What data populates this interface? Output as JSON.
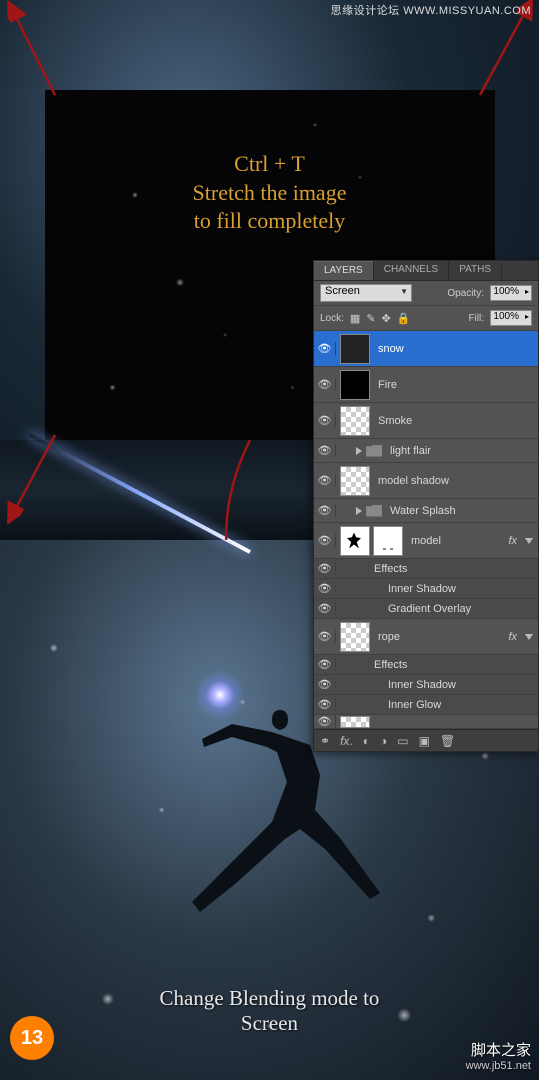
{
  "watermark_top": "思缘设计论坛  WWW.MISSYUAN.COM",
  "watermark_bottom": {
    "line1": "脚本之家",
    "line2": "www.jb51.net"
  },
  "instruction_top": {
    "line1": "Ctrl + T",
    "line2": "Stretch the image",
    "line3": "to fill completely"
  },
  "instruction_bottom": {
    "line1": "Change Blending mode to",
    "line2": "Screen"
  },
  "step_number": "13",
  "panel": {
    "tabs": [
      "LAYERS",
      "CHANNELS",
      "PATHS"
    ],
    "active_tab": 0,
    "blend_mode": "Screen",
    "opacity_label": "Opacity:",
    "opacity_value": "100%",
    "lock_label": "Lock:",
    "fill_label": "Fill:",
    "fill_value": "100%",
    "layers": [
      {
        "name": "snow",
        "selected": true
      },
      {
        "name": "Fire"
      },
      {
        "name": "Smoke"
      },
      {
        "name": "light flair",
        "group": true
      },
      {
        "name": "model shadow"
      },
      {
        "name": "Water Splash",
        "group": true
      },
      {
        "name": "model",
        "fx": true,
        "effects": [
          "Effects",
          "Inner Shadow",
          "Gradient Overlay"
        ]
      },
      {
        "name": "rope",
        "fx": true,
        "effects": [
          "Effects",
          "Inner Shadow",
          "Inner Glow"
        ]
      }
    ]
  }
}
